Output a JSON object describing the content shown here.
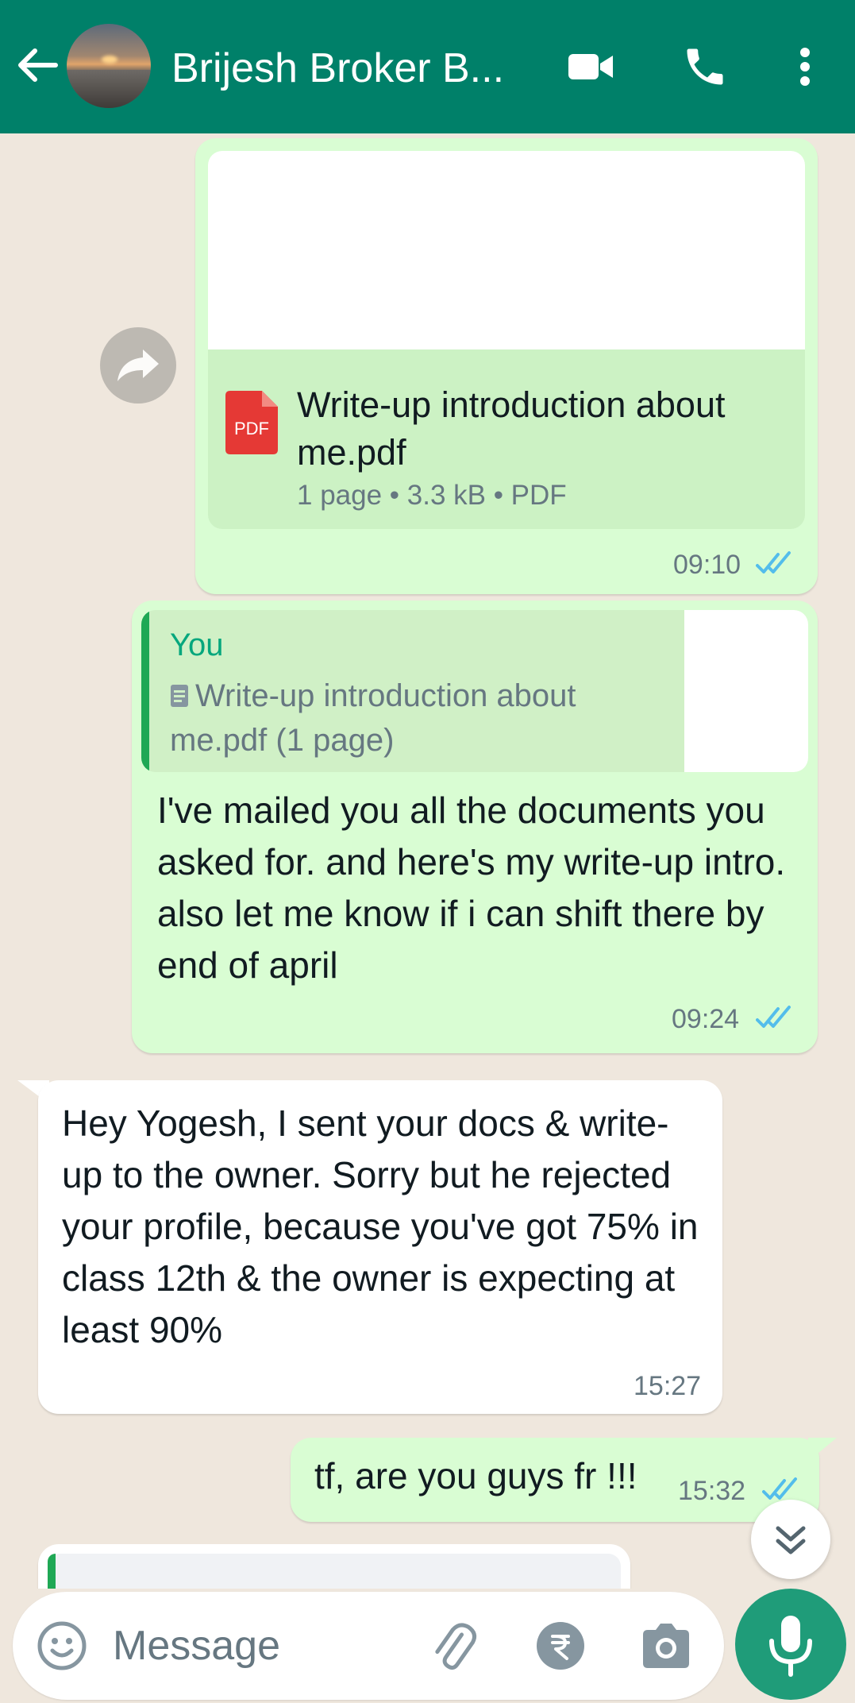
{
  "header": {
    "title": "Brijesh Broker B...",
    "bg_color": "#008069"
  },
  "messages": {
    "doc": {
      "file_name": "Write-up introduction about me.pdf",
      "file_badge": "PDF",
      "meta": "1 page • 3.3 kB • PDF",
      "time": "09:10"
    },
    "reply": {
      "quote_author": "You",
      "quote_text": "Write-up introduction about me.pdf (1 page)",
      "text": "I've mailed you all the documents you asked for. and here's my write-up intro. also let me know if i can shift there by end of april",
      "time": "09:24"
    },
    "incoming": {
      "text": "Hey Yogesh, I sent your docs & write-up to the owner. Sorry but he rejected your profile, because you've got 75% in class 12th & the owner is expecting at least 90%",
      "time": "15:27"
    },
    "last_out": {
      "text": "tf, are you guys fr !!!",
      "time": "15:32"
    }
  },
  "input": {
    "placeholder": "Message"
  },
  "colors": {
    "outgoing_bubble": "#d9fdd3",
    "incoming_bubble": "#ffffff",
    "read_ticks": "#53bdeb",
    "chat_bg": "#efe7dd",
    "mic_button": "#1f9c79"
  }
}
